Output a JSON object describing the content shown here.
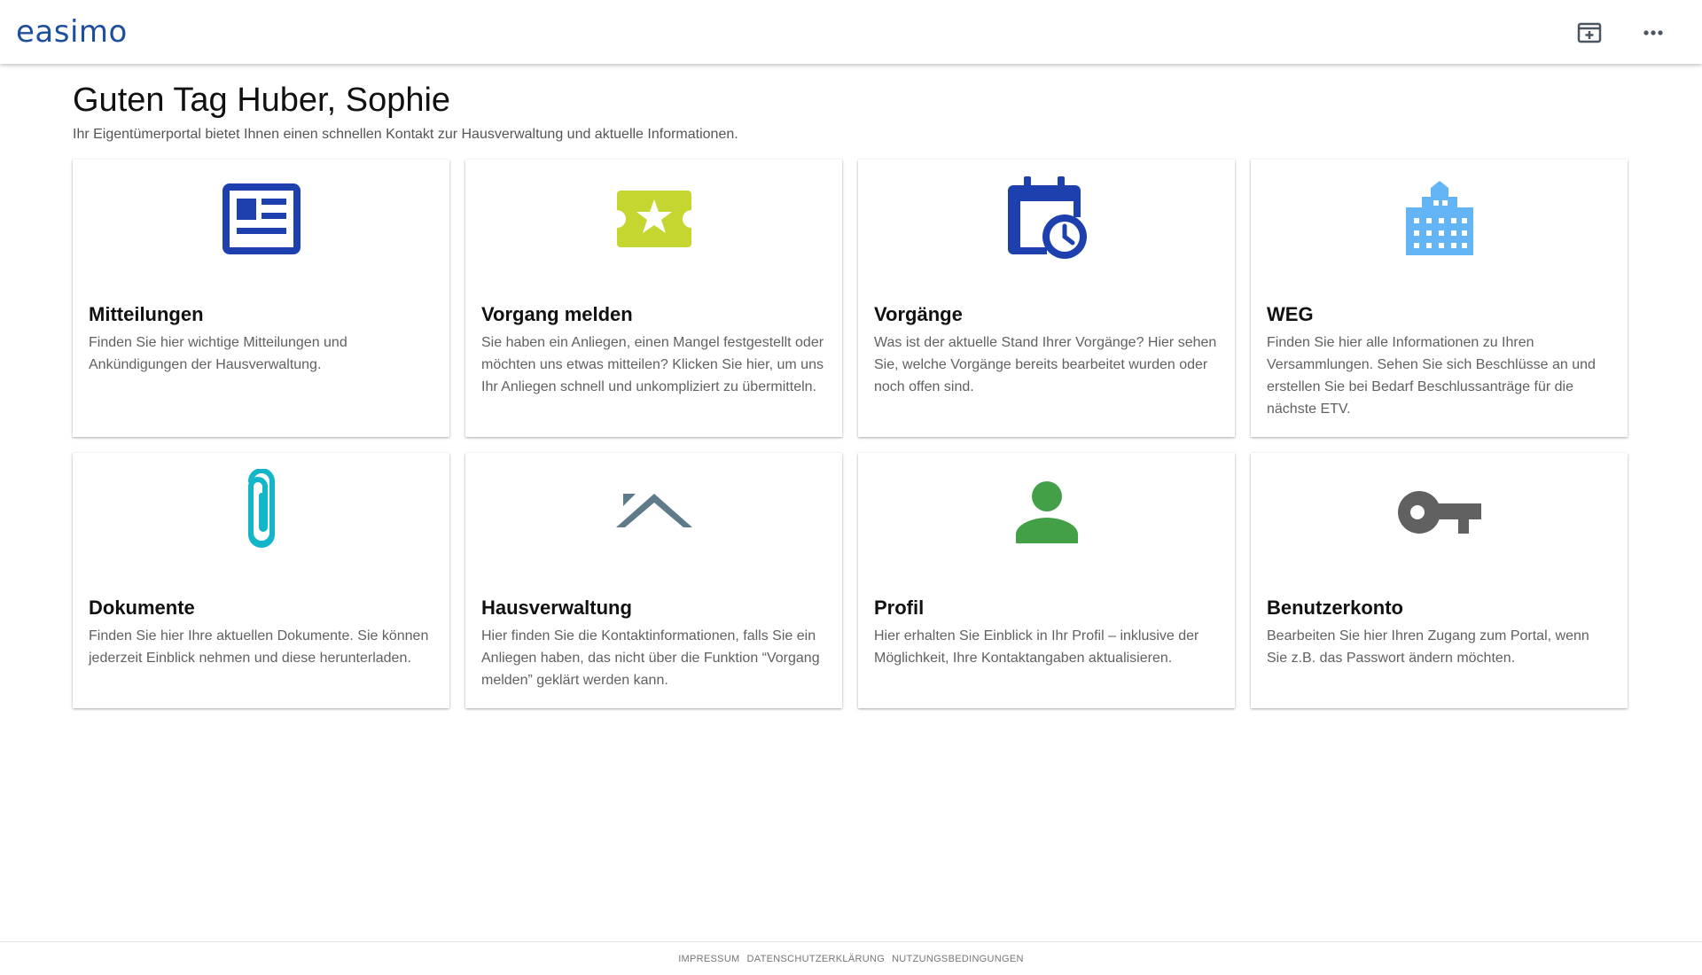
{
  "app": {
    "logo_text": "easimo",
    "brand_color": "#1e4f9c"
  },
  "header": {
    "actions": [
      {
        "icon": "add-window-icon"
      },
      {
        "icon": "more-horizontal-icon"
      }
    ]
  },
  "main": {
    "greeting": "Guten Tag Huber, Sophie",
    "subtitle": "Ihr Eigentümerportal bietet Ihnen einen schnellen Kontakt zur Hausverwaltung und aktuelle Informationen."
  },
  "cards": [
    {
      "title": "Mitteilungen",
      "text": "Finden Sie hier wichtige Mitteilungen und Ankündigungen der Hausverwaltung.",
      "icon": "newspaper-icon",
      "color": "#1e40af"
    },
    {
      "title": "Vorgang melden",
      "text": "Sie haben ein Anliegen, einen Mangel festgestellt oder möchten uns etwas mitteilen? Klicken Sie hier, um uns Ihr Anliegen schnell und unkompliziert zu übermitteln.",
      "icon": "star-ticket-icon",
      "color": "#c6d631"
    },
    {
      "title": "Vorgänge",
      "text": "Was ist der aktuelle Stand Ihrer Vorgänge? Hier sehen Sie, welche Vorgänge bereits bearbeitet wurden oder noch offen sind.",
      "icon": "calendar-clock-icon",
      "color": "#1e40af"
    },
    {
      "title": "WEG",
      "text": "Finden Sie hier alle Informationen zu Ihren Versammlungen. Sehen Sie sich Beschlüsse an und erstellen Sie bei Bedarf Beschlussanträge für die nächste ETV.",
      "icon": "building-icon",
      "color": "#64b5f6"
    },
    {
      "title": "Dokumente",
      "text": "Finden Sie hier Ihre aktuellen Dokumente. Sie können jederzeit Einblick nehmen und diese herunterladen.",
      "icon": "paperclip-icon",
      "color": "#13b5c9"
    },
    {
      "title": "Hausverwaltung",
      "text": "Hier finden Sie die Kontaktinformationen, falls Sie ein Anliegen haben, das nicht über die Funktion “Vorgang melden” geklärt werden kann.",
      "icon": "roof-icon",
      "color": "#5f7a89"
    },
    {
      "title": "Profil",
      "text": "Hier erhalten Sie Einblick in Ihr Profil – inklusive der Möglichkeit, Ihre Kontaktangaben aktualisieren.",
      "icon": "person-icon",
      "color": "#43a047"
    },
    {
      "title": "Benutzerkonto",
      "text": "Bearbeiten Sie hier Ihren Zugang zum Portal, wenn Sie z.B. das Passwort ändern möchten.",
      "icon": "key-icon",
      "color": "#616161"
    }
  ],
  "footer": {
    "links": [
      "IMPRESSUM",
      "DATENSCHUTZERKLÄRUNG",
      "NUTZUNGSBEDINGUNGEN"
    ]
  }
}
